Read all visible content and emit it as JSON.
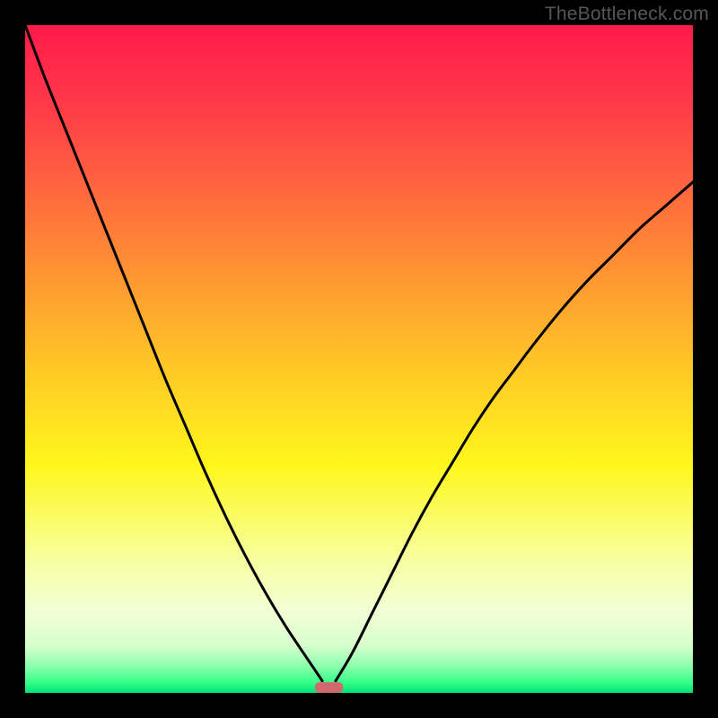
{
  "watermark": {
    "text": "TheBottleneck.com"
  },
  "chart_data": {
    "type": "line",
    "title": "",
    "xlabel": "",
    "ylabel": "",
    "xlim": [
      0,
      100
    ],
    "ylim": [
      0,
      100
    ],
    "grid": false,
    "legend": false,
    "annotations": [],
    "background_gradient_stops": [
      {
        "offset": 0.0,
        "color": "#ff1a4b"
      },
      {
        "offset": 0.12,
        "color": "#ff3a49"
      },
      {
        "offset": 0.3,
        "color": "#ff7a39"
      },
      {
        "offset": 0.5,
        "color": "#ffc327"
      },
      {
        "offset": 0.66,
        "color": "#fff71c"
      },
      {
        "offset": 0.8,
        "color": "#f7ffa0"
      },
      {
        "offset": 0.88,
        "color": "#f2ffd6"
      },
      {
        "offset": 0.93,
        "color": "#d6ffcc"
      },
      {
        "offset": 0.96,
        "color": "#8cffad"
      },
      {
        "offset": 0.985,
        "color": "#33ff88"
      },
      {
        "offset": 1.0,
        "color": "#00e27a"
      }
    ],
    "curve_notch": {
      "x": 45.5,
      "value": 0
    },
    "left_curve": {
      "x": [
        0,
        3,
        6,
        9,
        12,
        15,
        18,
        21,
        24,
        27,
        30,
        33,
        36,
        39,
        42,
        44.5
      ],
      "y": [
        100,
        92,
        84.5,
        77,
        69.5,
        62,
        54.5,
        47,
        40,
        33,
        26.5,
        20.5,
        15,
        10,
        5.5,
        1.8
      ]
    },
    "right_curve": {
      "x": [
        46.5,
        49,
        52,
        55,
        58,
        61,
        64,
        67,
        70,
        73,
        76,
        80,
        84,
        88,
        92,
        96,
        100
      ],
      "y": [
        1.8,
        6,
        12,
        18,
        24,
        29.5,
        34.5,
        39.5,
        44,
        48,
        52,
        57,
        61.5,
        65.5,
        69.5,
        73,
        76.5
      ]
    },
    "marker": {
      "x_center": 45.5,
      "width_pct": 4.2,
      "height_pct": 1.6,
      "color": "#d06a6f"
    }
  }
}
